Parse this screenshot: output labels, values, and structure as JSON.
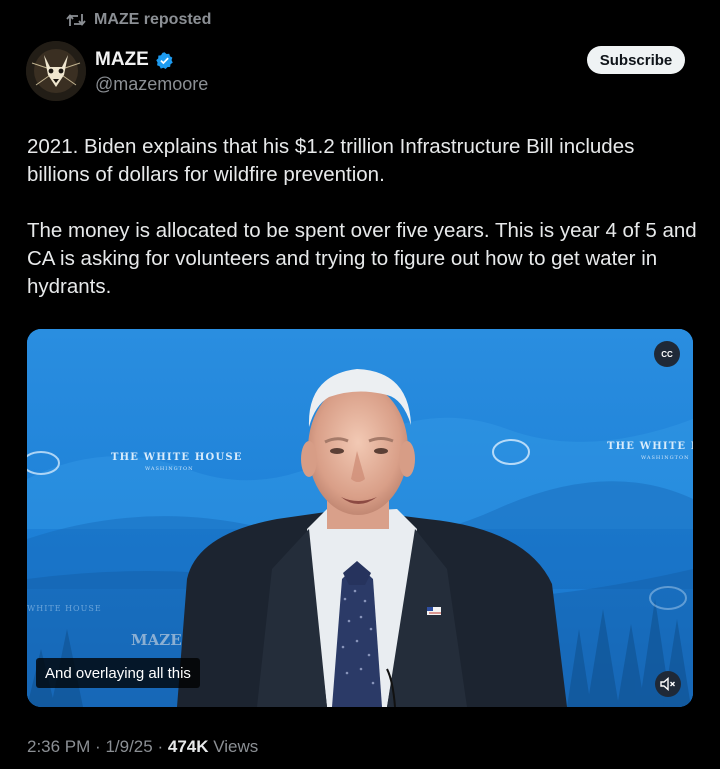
{
  "repost": {
    "label": "MAZE reposted",
    "icon": "repost-icon"
  },
  "author": {
    "name": "MAZE",
    "handle": "@mazemoore",
    "verified": true,
    "verified_color": "#1d9bf0"
  },
  "subscribe_label": "Subscribe",
  "tweet": {
    "paragraph1": "2021. Biden explains that his $1.2 trillion Infrastructure Bill includes billions of dollars for wildfire prevention.",
    "paragraph2": "The money is allocated to be spent over five years. This is year 4 of 5 and CA is asking for volunteers and trying to figure out how to get water in hydrants."
  },
  "video": {
    "caption": "And overlaying all this",
    "cc_label": "CC",
    "backdrop_text_left": "THE WHITE HOUSE",
    "backdrop_subtext_left": "WASHINGTON",
    "backdrop_text_right": "THE WHITE H",
    "backdrop_subtext_right": "WASHINGTON",
    "watermark": "MAZE",
    "backdrop_lower_text": "WHITE HOUSE"
  },
  "meta": {
    "time": "2:36 PM",
    "separator": "·",
    "date": "1/9/25",
    "views_count": "474K",
    "views_label": "Views"
  }
}
